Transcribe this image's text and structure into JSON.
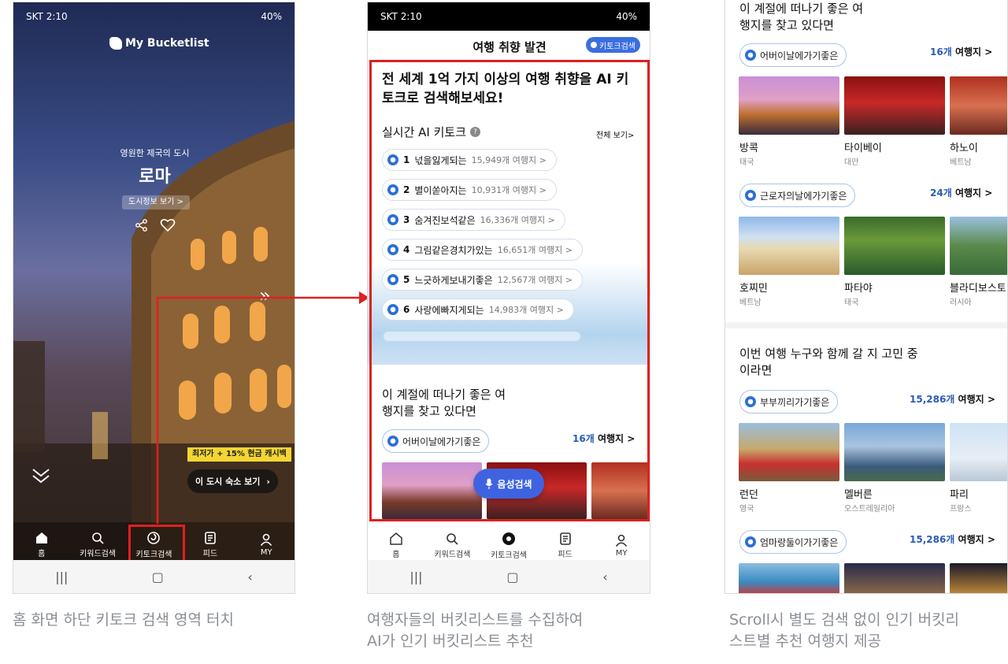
{
  "phone1": {
    "status": {
      "carrier": "SKT 2:10",
      "right": "40%"
    },
    "logo_text": "My Bucketlist",
    "city_subtitle": "영원한 제국의 도시",
    "city_title": "로마",
    "city_info_button": "도시정보 보기 >",
    "promo_badge": "최저가 + 15% 현금 캐시백",
    "hotel_button": "이 도시 숙소 보기",
    "nav": [
      {
        "label": "홈",
        "icon": "home-icon"
      },
      {
        "label": "키워드검색",
        "icon": "search-icon"
      },
      {
        "label": "키토크검색",
        "icon": "swirl-icon"
      },
      {
        "label": "피드",
        "icon": "feed-icon"
      },
      {
        "label": "MY",
        "icon": "person-icon"
      }
    ]
  },
  "phone2": {
    "status": {
      "carrier": "SKT 2:10",
      "right": "40%"
    },
    "header_title": "여행 취향 발견",
    "header_badge": "키토크검색",
    "headline": "전 세계 1억 가지 이상의 여행 취향을 AI 키토크로 검색해보세요!",
    "realtime_title": "실시간 AI 키토크",
    "view_all": "전체 보기>",
    "keywords": [
      {
        "rank": "1",
        "word": "넋을잃게되는",
        "count": "15,949개 여행지 >"
      },
      {
        "rank": "2",
        "word": "별이쏟아지는",
        "count": "10,931개 여행지 >"
      },
      {
        "rank": "3",
        "word": "숨겨진보석같은",
        "count": "16,336개 여행지 >"
      },
      {
        "rank": "4",
        "word": "그림같은경치가있는",
        "count": "16,651개 여행지 >"
      },
      {
        "rank": "5",
        "word": "느긋하게보내기좋은",
        "count": "12,567개 여행지 >"
      },
      {
        "rank": "6",
        "word": "사랑에빠지게되는",
        "count": "14,983개 여행지 >"
      }
    ],
    "section_title": "이 계절에 떠나기 좋은 여행지를 찾고 있다면",
    "section_chip": "어버이날에가기좋은",
    "section_count_num": "16개",
    "section_count_label": "여행지 >",
    "voice_button": "음성검색",
    "nav": [
      {
        "label": "홈",
        "icon": "home-icon"
      },
      {
        "label": "키워드검색",
        "icon": "search-icon"
      },
      {
        "label": "키토크검색",
        "icon": "swirl-icon"
      },
      {
        "label": "피드",
        "icon": "feed-icon"
      },
      {
        "label": "MY",
        "icon": "person-icon"
      }
    ]
  },
  "phone3": {
    "top_title": "이 계절에 떠나기 좋은 여행지를 찾고 있다면",
    "groups": [
      {
        "chip": "어버이날에가기좋은",
        "count_num": "16개",
        "count_label": "여행지 >",
        "cities": [
          {
            "name": "방콕",
            "country": "태국"
          },
          {
            "name": "타이베이",
            "country": "대만"
          },
          {
            "name": "하노이",
            "country": "베트남"
          }
        ]
      },
      {
        "chip": "근로자의날에가기좋은",
        "count_num": "24개",
        "count_label": "여행지 >",
        "cities": [
          {
            "name": "호찌민",
            "country": "베트남"
          },
          {
            "name": "파타야",
            "country": "태국"
          },
          {
            "name": "블라디보스토",
            "country": "러시아"
          }
        ]
      }
    ],
    "second_title": "이번 여행 누구와 함께 갈 지 고민 중이라면",
    "groups2": [
      {
        "chip": "부부끼리가기좋은",
        "count_num": "15,286개",
        "count_label": "여행지 >",
        "cities": [
          {
            "name": "런던",
            "country": "영국"
          },
          {
            "name": "멜버른",
            "country": "오스트레일리아"
          },
          {
            "name": "파리",
            "country": "프랑스"
          }
        ]
      },
      {
        "chip": "엄마랑둘이가기좋은",
        "count_num": "15,286개",
        "count_label": "여행지 >"
      }
    ]
  },
  "captions": {
    "c1": "홈 화면 하단 키토크 검색 영역 터치",
    "c2_line1": "여행자들의 버킷리스트를 수집하여",
    "c2_line2": "AI가 인기 버킷리스트 추천",
    "c3_line1": "Scroll시 별도 검색 없이 인기 버킷리",
    "c3_line2": "스트별 추천 여행지 제공"
  },
  "colors": {
    "highlight_red": "#e02020",
    "accent_blue": "#2a5bb5",
    "voice_blue": "#3f63e0"
  }
}
